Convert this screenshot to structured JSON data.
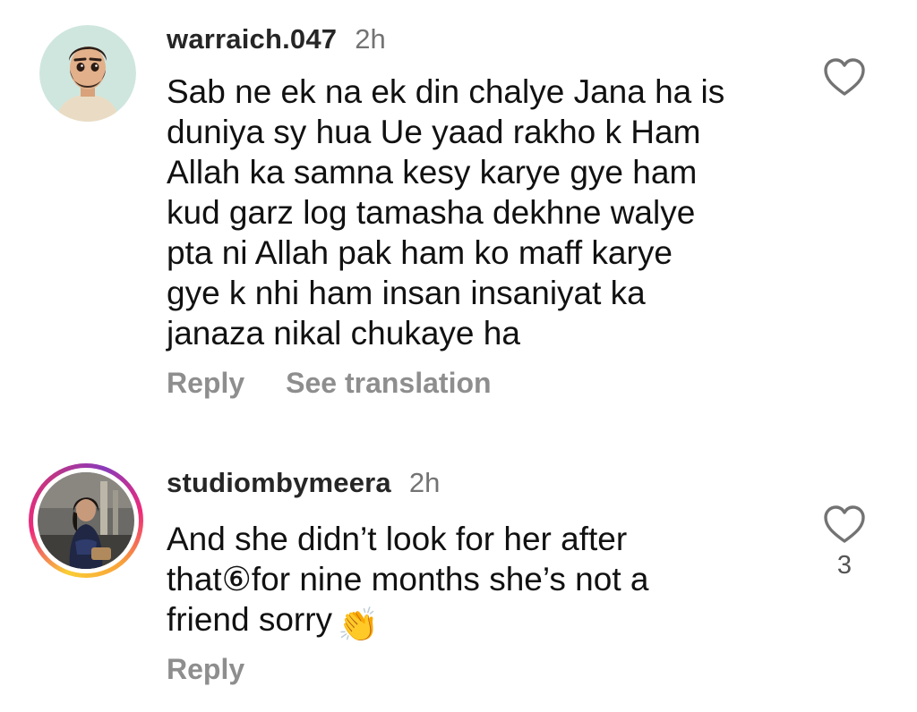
{
  "comments": [
    {
      "username": "warraich.047",
      "time": "2h",
      "body_lines": [
        "Sab ne ek na ek din chalye Jana ha is",
        "duniya sy hua Ue yaad rakho k Ham",
        "Allah ka samna kesy karye gye ham",
        "kud garz log tamasha dekhne walye",
        "pta ni Allah pak ham ko maff karye",
        "gye k nhi ham insan insaniyat ka",
        "janaza nikal chukaye ha"
      ],
      "actions": {
        "reply": "Reply",
        "translate": "See translation"
      },
      "like_count": "",
      "avatar_icon": "cartoon-man-avatar"
    },
    {
      "username": "studiombymeera",
      "time": "2h",
      "body_lines": [
        "And she didn’t look for her after",
        "that⑥for nine months she’s not a",
        "friend sorry"
      ],
      "emoji": "👏",
      "actions": {
        "reply": "Reply"
      },
      "like_count": "3",
      "avatar_icon": "photo-avatar-with-story-ring"
    }
  ],
  "colors": {
    "username": "#262626",
    "meta": "#737373",
    "action": "#8e8e8e",
    "story_ring_start": "#f9ce34",
    "story_ring_mid": "#ee2a7b",
    "story_ring_end": "#8a3ab9"
  }
}
